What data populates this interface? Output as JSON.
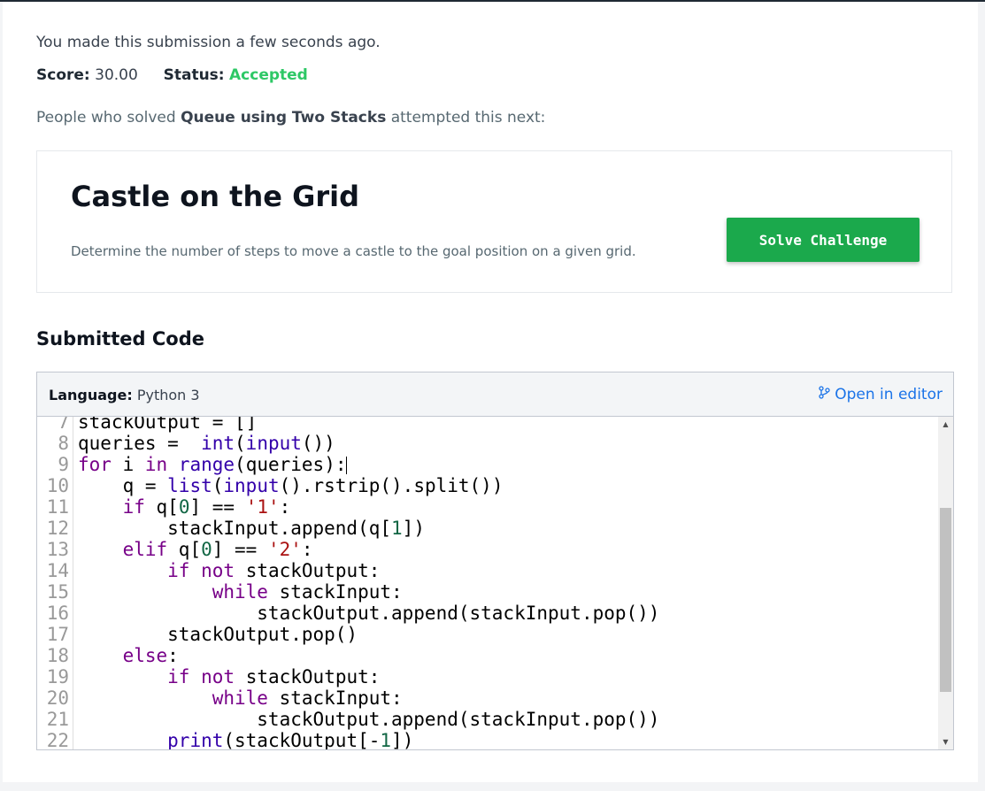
{
  "submission": {
    "message": "You made this submission a few seconds ago.",
    "score_label": "Score:",
    "score_value": "30.00",
    "status_label": "Status:",
    "status_value": "Accepted"
  },
  "next": {
    "prefix": "People who solved ",
    "problem": "Queue using Two Stacks",
    "suffix": " attempted this next:"
  },
  "challenge": {
    "title": "Castle on the Grid",
    "description": "Determine the number of steps to move a castle to the goal position on a given grid.",
    "button_label": "Solve Challenge"
  },
  "code_section": {
    "title": "Submitted Code",
    "language_label": "Language:",
    "language_value": "Python 3",
    "open_editor_label": "Open in editor"
  },
  "colors": {
    "accent_green": "#1ba94c",
    "status_green": "#2ec866",
    "link_blue": "#1a73e8"
  },
  "code_lines": [
    {
      "n": "7",
      "text": "stackOutput = []"
    },
    {
      "n": "8",
      "text": "queries =  int(input())"
    },
    {
      "n": "9",
      "text": "for i in range(queries):"
    },
    {
      "n": "10",
      "text": "    q = list(input().rstrip().split())"
    },
    {
      "n": "11",
      "text": "    if q[0] == '1':"
    },
    {
      "n": "12",
      "text": "        stackInput.append(q[1])"
    },
    {
      "n": "13",
      "text": "    elif q[0] == '2':"
    },
    {
      "n": "14",
      "text": "        if not stackOutput:"
    },
    {
      "n": "15",
      "text": "            while stackInput:"
    },
    {
      "n": "16",
      "text": "                stackOutput.append(stackInput.pop())"
    },
    {
      "n": "17",
      "text": "        stackOutput.pop()"
    },
    {
      "n": "18",
      "text": "    else:"
    },
    {
      "n": "19",
      "text": "        if not stackOutput:"
    },
    {
      "n": "20",
      "text": "            while stackInput:"
    },
    {
      "n": "21",
      "text": "                stackOutput.append(stackInput.pop())"
    },
    {
      "n": "22",
      "text": "        print(stackOutput[-1])"
    }
  ]
}
